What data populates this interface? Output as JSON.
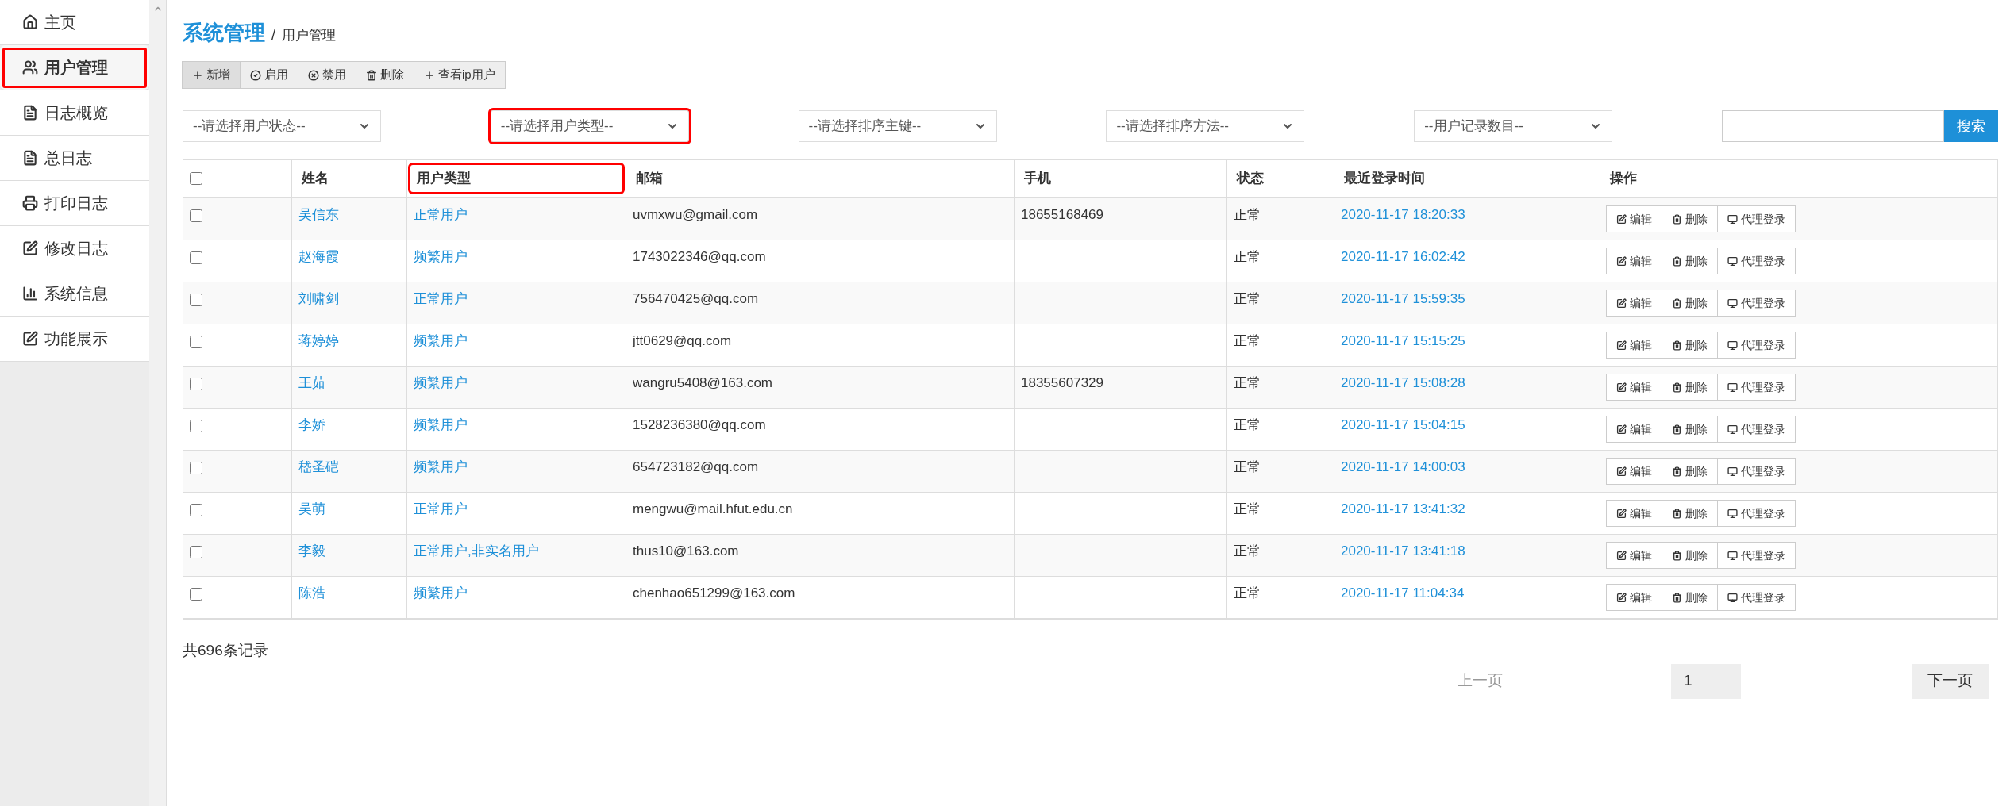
{
  "sidebar": {
    "items": [
      {
        "label": "主页",
        "selected": false,
        "highlighted": false
      },
      {
        "label": "用户管理",
        "selected": true,
        "highlighted": true
      },
      {
        "label": "日志概览",
        "selected": false,
        "highlighted": false
      },
      {
        "label": "总日志",
        "selected": false,
        "highlighted": false
      },
      {
        "label": "打印日志",
        "selected": false,
        "highlighted": false
      },
      {
        "label": "修改日志",
        "selected": false,
        "highlighted": false
      },
      {
        "label": "系统信息",
        "selected": false,
        "highlighted": false
      },
      {
        "label": "功能展示",
        "selected": false,
        "highlighted": false
      }
    ]
  },
  "breadcrumb": {
    "title": "系统管理",
    "separator": "/",
    "current": "用户管理"
  },
  "toolbar": [
    "新增",
    "启用",
    "禁用",
    "删除",
    "查看ip用户"
  ],
  "filters": [
    {
      "placeholder": "--请选择用户状态--",
      "highlighted": false
    },
    {
      "placeholder": "--请选择用户类型--",
      "highlighted": true
    },
    {
      "placeholder": "--请选择排序主键--",
      "highlighted": false
    },
    {
      "placeholder": "--请选择排序方法--",
      "highlighted": false
    },
    {
      "placeholder": "--用户记录数目--",
      "highlighted": false
    }
  ],
  "search": {
    "button": "搜索"
  },
  "table": {
    "columns": [
      {
        "label": "姓名",
        "highlighted": false
      },
      {
        "label": "用户类型",
        "highlighted": true
      },
      {
        "label": "邮箱",
        "highlighted": false
      },
      {
        "label": "手机",
        "highlighted": false
      },
      {
        "label": "状态",
        "highlighted": false
      },
      {
        "label": "最近登录时间",
        "highlighted": false
      },
      {
        "label": "操作",
        "highlighted": false
      }
    ],
    "header_checked": false,
    "rows": [
      {
        "checked": false,
        "name": "吴信东",
        "type": "正常用户",
        "email": "uvmxwu@gmail.com",
        "phone": "18655168469",
        "status": "正常",
        "last_login": "2020-11-17 18:20:33",
        "actions": [
          "编辑",
          "删除",
          "代理登录"
        ]
      },
      {
        "checked": false,
        "name": "赵海霞",
        "type": "频繁用户",
        "email": "1743022346@qq.com",
        "status": "正常",
        "last_login": "2020-11-17 16:02:42",
        "actions": [
          "编辑",
          "删除",
          "代理登录"
        ]
      },
      {
        "checked": false,
        "name": "刘啸剑",
        "type": "正常用户",
        "email": "756470425@qq.com",
        "status": "正常",
        "last_login": "2020-11-17 15:59:35",
        "actions": [
          "编辑",
          "删除",
          "代理登录"
        ]
      },
      {
        "checked": false,
        "name": "蒋婷婷",
        "type": "频繁用户",
        "email": "jtt0629@qq.com",
        "status": "正常",
        "last_login": "2020-11-17 15:15:25",
        "actions": [
          "编辑",
          "删除",
          "代理登录"
        ]
      },
      {
        "checked": false,
        "name": "王茹",
        "type": "频繁用户",
        "email": "wangru5408@163.com",
        "phone": "18355607329",
        "status": "正常",
        "last_login": "2020-11-17 15:08:28",
        "actions": [
          "编辑",
          "删除",
          "代理登录"
        ]
      },
      {
        "checked": false,
        "name": "李娇",
        "type": "频繁用户",
        "email": "1528236380@qq.com",
        "status": "正常",
        "last_login": "2020-11-17 15:04:15",
        "actions": [
          "编辑",
          "删除",
          "代理登录"
        ]
      },
      {
        "checked": false,
        "name": "嵇圣硙",
        "type": "频繁用户",
        "email": "654723182@qq.com",
        "status": "正常",
        "last_login": "2020-11-17 14:00:03",
        "actions": [
          "编辑",
          "删除",
          "代理登录"
        ]
      },
      {
        "checked": false,
        "name": "吴萌",
        "type": "正常用户",
        "email": "mengwu@mail.hfut.edu.cn",
        "status": "正常",
        "last_login": "2020-11-17 13:41:32",
        "actions": [
          "编辑",
          "删除",
          "代理登录"
        ]
      },
      {
        "checked": false,
        "name": "李毅",
        "type": "正常用户,非实名用户",
        "email": "thus10@163.com",
        "status": "正常",
        "last_login": "2020-11-17 13:41:18",
        "actions": [
          "编辑",
          "删除",
          "代理登录"
        ]
      },
      {
        "checked": false,
        "name": "陈浩",
        "type": "频繁用户",
        "email": "chenhao651299@163.com",
        "status": "正常",
        "last_login": "2020-11-17 11:04:34",
        "actions": [
          "编辑",
          "删除",
          "代理登录"
        ]
      }
    ]
  },
  "total": "共696条记录",
  "pagination": {
    "prev": "上一页",
    "page": "1",
    "next": "下一页"
  }
}
